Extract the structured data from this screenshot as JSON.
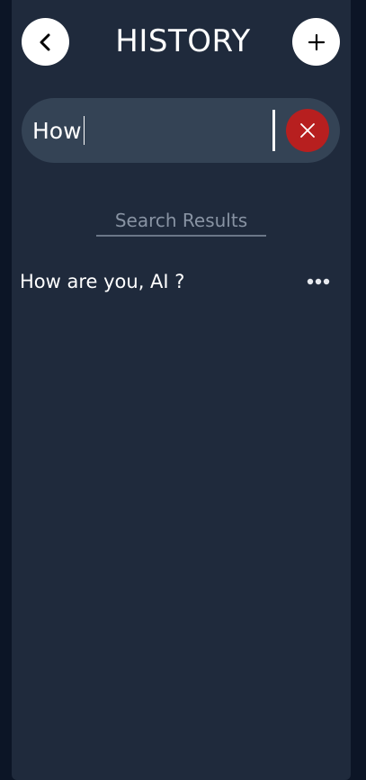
{
  "header": {
    "title": "HISTORY",
    "back_icon": "chevron-left-icon",
    "add_icon": "plus-icon"
  },
  "search": {
    "value": "How",
    "clear_icon": "close-icon"
  },
  "results": {
    "heading": "Search Results",
    "items": [
      {
        "label": "How are you, AI ?",
        "menu_icon": "more-horizontal-icon"
      }
    ]
  },
  "colors": {
    "background": "#0c1526",
    "panel": "#1f2a3c",
    "search_bar": "#344355",
    "clear_button": "#b71f1f",
    "muted_text": "#8893a3"
  }
}
